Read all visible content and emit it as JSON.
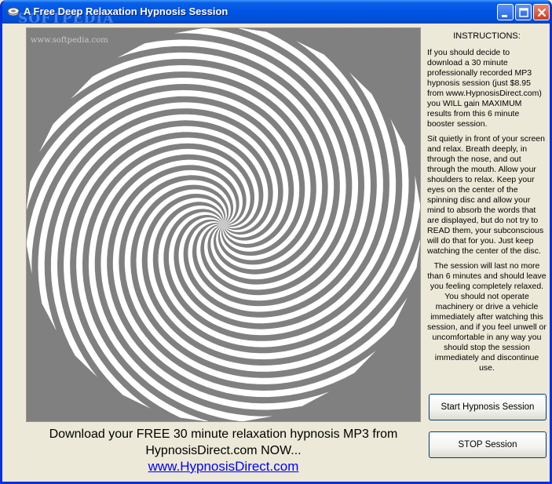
{
  "window": {
    "title": "A Free Deep Relaxation Hypnosis Session",
    "watermark": "SOFTPEDIA",
    "watermark_url": "www.softpedia.com"
  },
  "instructions": {
    "heading": "INSTRUCTIONS:",
    "paragraphs": [
      "If you should decide to download a 30 minute professionally recorded MP3 hypnosis session (just $8.95 from www.HypnosisDirect.com) you WILL gain MAXIMUM results from this 6 minute booster session.",
      "Sit quietly in front of your screen and relax. Breath deeply, in through the nose, and out through the mouth. Allow your shoulders to relax. Keep your eyes on the center of the spinning disc and allow your mind to absorb the words that are displayed, but do not try to READ them, your subconscious will do that for you. Just keep watching the center of the disc.",
      "The session will last no more than 6 minutes and should leave you feeling completely relaxed. You should not operate machinery or drive a vehicle immediately after watching this session, and if you feel unwell or uncomfortable in any way you should stop the session immediately and discontinue use."
    ]
  },
  "buttons": {
    "start_label": "Start Hypnosis Session",
    "stop_label": "STOP Session"
  },
  "promo": {
    "text": "Download your FREE 30 minute relaxation hypnosis MP3 from HypnosisDirect.com NOW...",
    "link_text": "www.HypnosisDirect.com"
  },
  "spiral": {
    "arms": 20,
    "colors": {
      "light": "#ffffff",
      "dark": "#808080"
    }
  },
  "colors": {
    "titlebar": "#0054e3",
    "window_bg": "#ece9d8",
    "link": "#0000ff"
  }
}
